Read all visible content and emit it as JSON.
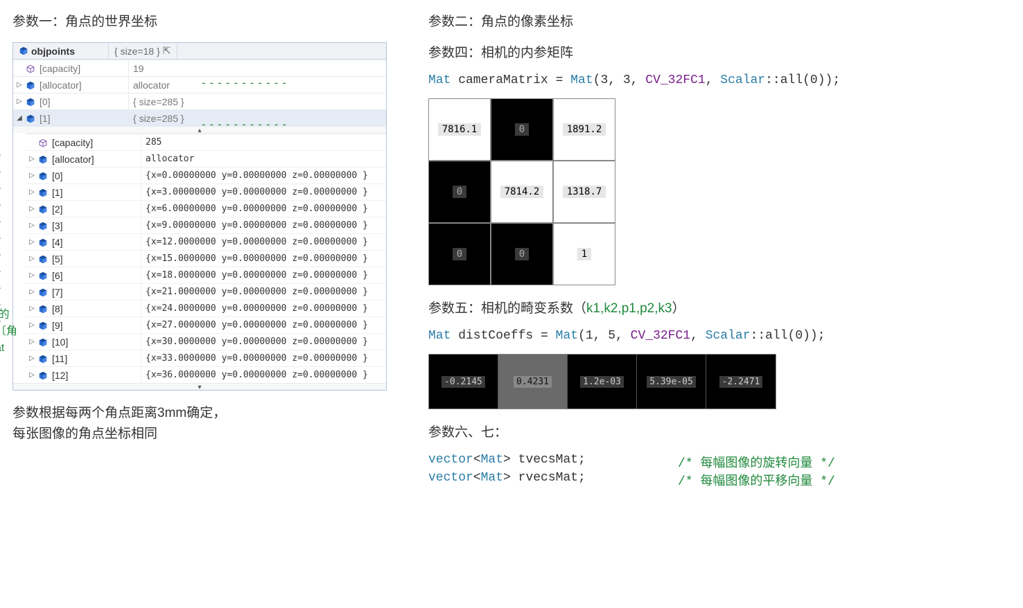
{
  "left": {
    "title": "参数一：角点的世界坐标",
    "debugger": {
      "var_name": "objpoints",
      "var_summary": "{ size=18 }",
      "outer_rows": [
        {
          "name": "[capacity]",
          "value": "19",
          "icon": "outline",
          "expander": ""
        },
        {
          "name": "[allocator]",
          "value": "allocator",
          "icon": "solid",
          "expander": "▷"
        },
        {
          "name": "[0]",
          "value": "{ size=285 }",
          "icon": "solid",
          "expander": "▷"
        },
        {
          "name": "[1]",
          "value": "{ size=285 }",
          "icon": "solid",
          "expander": "◢",
          "selected": true
        }
      ],
      "inner_header": [
        {
          "name": "[capacity]",
          "value": "285",
          "icon": "outline"
        },
        {
          "name": "[allocator]",
          "value": "allocator",
          "icon": "solid"
        }
      ],
      "inner_rows": [
        {
          "idx": "[0]",
          "x": "0.00000000",
          "y": "0.00000000",
          "z": "0.00000000"
        },
        {
          "idx": "[1]",
          "x": "3.00000000",
          "y": "0.00000000",
          "z": "0.00000000"
        },
        {
          "idx": "[2]",
          "x": "6.00000000",
          "y": "0.00000000",
          "z": "0.00000000"
        },
        {
          "idx": "[3]",
          "x": "9.00000000",
          "y": "0.00000000",
          "z": "0.00000000"
        },
        {
          "idx": "[4]",
          "x": "12.0000000",
          "y": "0.00000000",
          "z": "0.00000000"
        },
        {
          "idx": "[5]",
          "x": "15.0000000",
          "y": "0.00000000",
          "z": "0.00000000"
        },
        {
          "idx": "[6]",
          "x": "18.0000000",
          "y": "0.00000000",
          "z": "0.00000000"
        },
        {
          "idx": "[7]",
          "x": "21.0000000",
          "y": "0.00000000",
          "z": "0.00000000"
        },
        {
          "idx": "[8]",
          "x": "24.0000000",
          "y": "0.00000000",
          "z": "0.00000000"
        },
        {
          "idx": "[9]",
          "x": "27.0000000",
          "y": "0.00000000",
          "z": "0.00000000"
        },
        {
          "idx": "[10]",
          "x": "30.0000000",
          "y": "0.00000000",
          "z": "0.00000000"
        },
        {
          "idx": "[11]",
          "x": "33.0000000",
          "y": "0.00000000",
          "z": "0.00000000"
        },
        {
          "idx": "[12]",
          "x": "36.0000000",
          "y": "0.00000000",
          "z": "0.00000000"
        }
      ]
    },
    "note_line1": "参数根据每两个角点距离3mm确定，",
    "note_line2": "每张图像的角点坐标相同",
    "frag1": "]的",
    "frag2": "〔角",
    "frag3": "at"
  },
  "right": {
    "title2": "参数二：角点的像素坐标",
    "title4": "参数四：相机的内参矩阵",
    "code_cam_pre": "Mat",
    "code_cam_mid": " cameraMatrix = ",
    "code_cam_mat": "Mat",
    "code_cam_args1": "(3, 3, ",
    "code_cam_const": "CV_32FC1",
    "code_cam_args2": ", ",
    "code_cam_scalar": "Scalar",
    "code_cam_tail": "::all(0));",
    "cam_matrix": [
      [
        "7816.1",
        "0",
        "1891.2"
      ],
      [
        "0",
        "7814.2",
        "1318.7"
      ],
      [
        "0",
        "0",
        "1"
      ]
    ],
    "cam_black_mask": [
      [
        false,
        true,
        false
      ],
      [
        true,
        false,
        false
      ],
      [
        true,
        true,
        false
      ]
    ],
    "title5_pre": "参数五：相机的畸变系数（",
    "title5_params": "k1,k2,p1,p2,k3",
    "title5_post": "）",
    "code_dist_pre": "Mat",
    "code_dist_mid": " distCoeffs = ",
    "code_dist_mat": "Mat",
    "code_dist_args1": "(1, 5, ",
    "code_dist_const": "CV_32FC1",
    "code_dist_args2": ", ",
    "code_dist_scalar": "Scalar",
    "code_dist_tail": "::all(0));",
    "dist_coeffs": [
      "-0.2145",
      "0.4231",
      "1.2e-03",
      "5.39e-05",
      "-2.2471"
    ],
    "dist_gray_idx": 1,
    "title67": "参数六、七：",
    "vec1_type": "vector",
    "vec1_inner": "Mat",
    "vec1_name": " tvecsMat;",
    "vec1_comment": "/* 每幅图像的旋转向量 */",
    "vec2_type": "vector",
    "vec2_inner": "Mat",
    "vec2_name": " rvecsMat;",
    "vec2_comment": "/* 每幅图像的平移向量 */"
  }
}
